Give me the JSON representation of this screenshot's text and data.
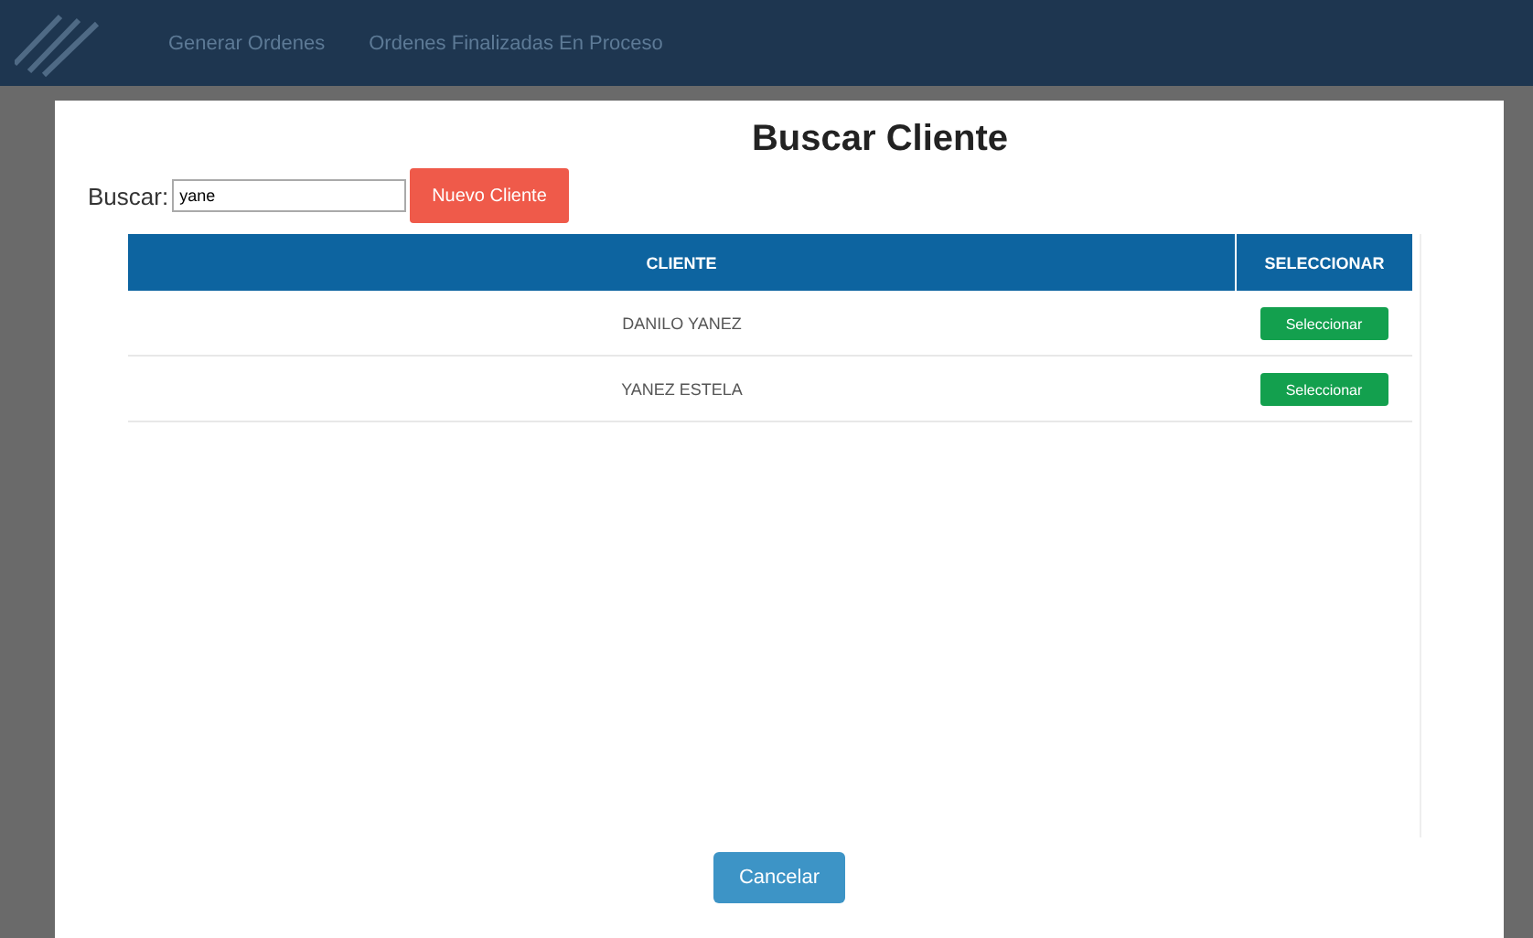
{
  "nav": {
    "links": [
      "Generar Ordenes",
      "Ordenes Finalizadas En Proceso"
    ]
  },
  "modal": {
    "title": "Buscar Cliente",
    "search_label": "Buscar:",
    "search_value": "yane",
    "new_button": "Nuevo Cliente",
    "table": {
      "columns": [
        "CLIENTE",
        "SELECCIONAR"
      ],
      "rows": [
        {
          "cliente": "DANILO YANEZ",
          "action": "Seleccionar"
        },
        {
          "cliente": "YANEZ ESTELA",
          "action": "Seleccionar"
        }
      ]
    },
    "cancel_button": "Cancelar"
  }
}
